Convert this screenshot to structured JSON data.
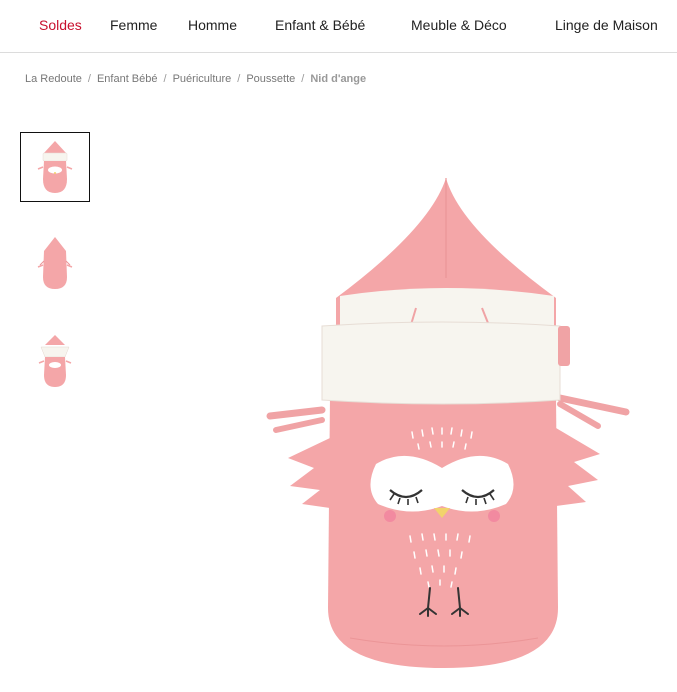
{
  "nav": {
    "items": [
      {
        "label": "Soldes"
      },
      {
        "label": "Femme"
      },
      {
        "label": "Homme"
      },
      {
        "label": "Enfant & Bébé"
      },
      {
        "label": "Meuble & Déco"
      },
      {
        "label": "Linge de Maison"
      }
    ],
    "sale_color": "#c8102e"
  },
  "breadcrumb": {
    "items": [
      "La Redoute",
      "Enfant Bébé",
      "Puériculture",
      "Poussette"
    ],
    "separator": "/",
    "current": "Nid d'ange"
  },
  "gallery": {
    "thumbnail_count": 3,
    "selected_index": 0
  },
  "product": {
    "main_color": "#f4a6a8",
    "lining_color": "#f7f5ef"
  }
}
